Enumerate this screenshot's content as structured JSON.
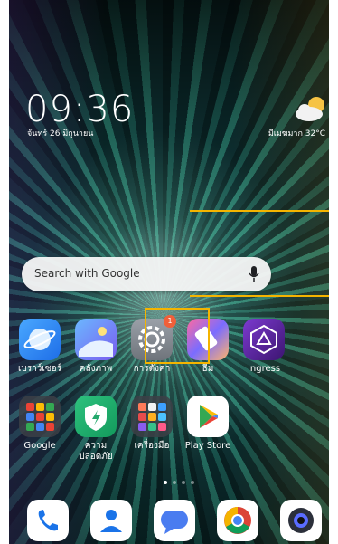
{
  "lockscreen": {
    "time": "09:36",
    "date": "จันทร์ 26 มิถุนายน",
    "weather_text": "มีเมฆมาก  32°C",
    "weather_icon": "partly-cloudy-icon"
  },
  "search": {
    "placeholder": "Search with Google",
    "mic_icon": "microphone-icon"
  },
  "apps_row1": [
    {
      "label": "เบราว์เซอร์",
      "icon": "browser-icon",
      "color": "#2b8cf5"
    },
    {
      "label": "คลังภาพ",
      "icon": "gallery-icon",
      "color": "#4d7cf5"
    },
    {
      "label": "การตั้งค่า",
      "icon": "settings-gear-icon",
      "color": "#8a8f98",
      "badge": "1"
    },
    {
      "label": "ธีม",
      "icon": "themes-icon",
      "color": "#e84c7d"
    },
    {
      "label": "Ingress",
      "icon": "ingress-icon",
      "color": "#6a2fa8"
    }
  ],
  "apps_row2": [
    {
      "label": "Google",
      "icon": "google-folder-icon",
      "color": "#3b3f44"
    },
    {
      "label": "ความ\nปลอดภัย",
      "icon": "security-shield-icon",
      "color": "#22a86b"
    },
    {
      "label": "เครื่องมือ",
      "icon": "tools-folder-icon",
      "color": "#3b3f44"
    },
    {
      "label": "Play Store",
      "icon": "play-store-icon",
      "color": "#ffffff"
    }
  ],
  "dock": [
    {
      "icon": "phone-icon",
      "color": "#ffffff"
    },
    {
      "icon": "contacts-icon",
      "color": "#ffffff"
    },
    {
      "icon": "messages-icon",
      "color": "#ffffff"
    },
    {
      "icon": "chrome-icon",
      "color": "#ffffff"
    },
    {
      "icon": "camera-icon",
      "color": "#ffffff"
    }
  ],
  "page_indicator": {
    "count": 4,
    "active": 0
  },
  "colors": {
    "highlight": "#f4b400",
    "badge": "#f0603a"
  }
}
